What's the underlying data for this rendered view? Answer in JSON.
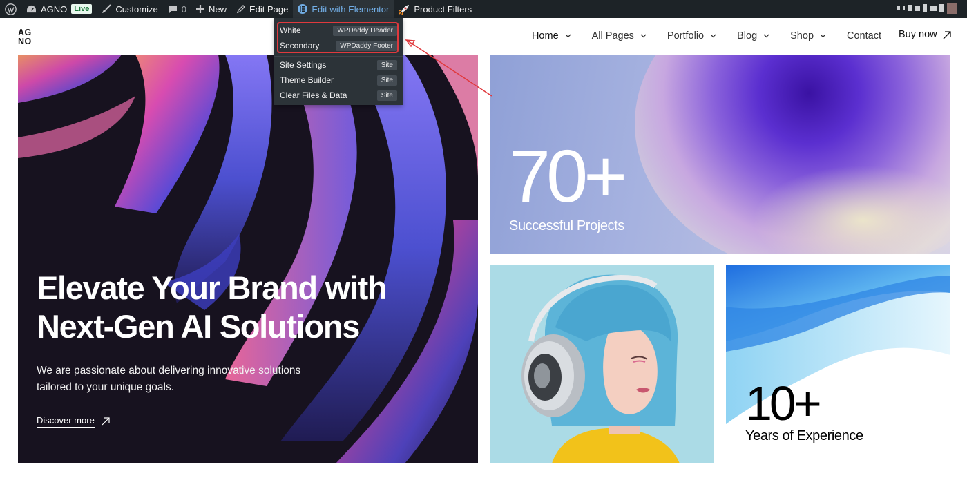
{
  "admin_bar": {
    "site_name": "AGNO",
    "live_badge": "Live",
    "customize": "Customize",
    "comments_count": "0",
    "new": "New",
    "edit_page": "Edit Page",
    "edit_with_elementor": "Edit with Elementor",
    "product_filters": "Product Filters"
  },
  "elementor_dropdown": {
    "items": [
      {
        "label": "White",
        "badge": "WPDaddy Header"
      },
      {
        "label": "Secondary",
        "badge": "WPDaddy Footer"
      },
      {
        "label": "Site Settings",
        "badge": "Site"
      },
      {
        "label": "Theme Builder",
        "badge": "Site"
      },
      {
        "label": "Clear Files & Data",
        "badge": "Site"
      }
    ]
  },
  "header": {
    "logo_line1": "AG",
    "logo_line2": "NO",
    "nav": [
      {
        "label": "Home",
        "has_dropdown": true
      },
      {
        "label": "All Pages",
        "has_dropdown": true
      },
      {
        "label": "Portfolio",
        "has_dropdown": true
      },
      {
        "label": "Blog",
        "has_dropdown": true
      },
      {
        "label": "Shop",
        "has_dropdown": true
      },
      {
        "label": "Contact",
        "has_dropdown": false
      }
    ],
    "cta": "Buy now"
  },
  "hero": {
    "title_line1": "Elevate Your Brand with",
    "title_line2": "Next-Gen AI Solutions",
    "subtitle_line1": "We are passionate about delivering innovative solutions",
    "subtitle_line2": "tailored to your unique goals.",
    "link": "Discover more"
  },
  "stats": {
    "projects": {
      "value": "70+",
      "label": "Successful Projects"
    },
    "experience": {
      "value": "10+",
      "label": "Years of Experience"
    }
  },
  "colors": {
    "admin_bar_bg": "#1d2327",
    "admin_accent": "#72aee6",
    "highlight_red": "#e0393d",
    "hero_bg": "#17121f"
  }
}
